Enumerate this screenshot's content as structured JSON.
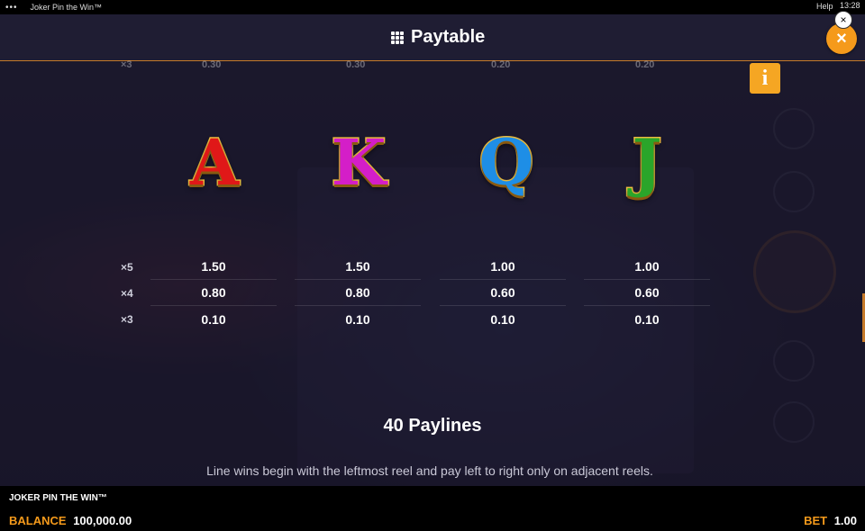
{
  "system_bar": {
    "menu_dots": "•••",
    "tab_title": "Joker Pin the Win™",
    "help": "Help",
    "time": "13:28"
  },
  "header": {
    "title": "Paytable",
    "close_glyph": "×",
    "small_close_glyph": "×"
  },
  "info_button": {
    "label": "i"
  },
  "peek_row": {
    "multiplier": "×3",
    "values": [
      "0.30",
      "0.30",
      "0.20",
      "0.20"
    ]
  },
  "multipliers": [
    "×5",
    "×4",
    "×3"
  ],
  "symbols": [
    {
      "letter": "A",
      "color": "#e01818",
      "payouts": [
        "1.50",
        "0.80",
        "0.10"
      ]
    },
    {
      "letter": "K",
      "color": "#d41ec8",
      "payouts": [
        "1.50",
        "0.80",
        "0.10"
      ]
    },
    {
      "letter": "Q",
      "color": "#1e8ee6",
      "payouts": [
        "1.00",
        "0.60",
        "0.10"
      ]
    },
    {
      "letter": "J",
      "color": "#2aa52a",
      "payouts": [
        "1.00",
        "0.60",
        "0.10"
      ]
    }
  ],
  "paylines": {
    "title": "40 Paylines",
    "description": "Line wins begin with the leftmost reel and pay left to right only on adjacent reels."
  },
  "footer": {
    "game_name": "JOKER PIN THE WIN™",
    "balance_label": "BALANCE",
    "balance_value": "100,000.00",
    "bet_label": "BET",
    "bet_value": "1.00"
  },
  "colors": {
    "accent": "#f59a1b",
    "header_bg": "#1f1d33",
    "divider": "#c67a2a"
  }
}
